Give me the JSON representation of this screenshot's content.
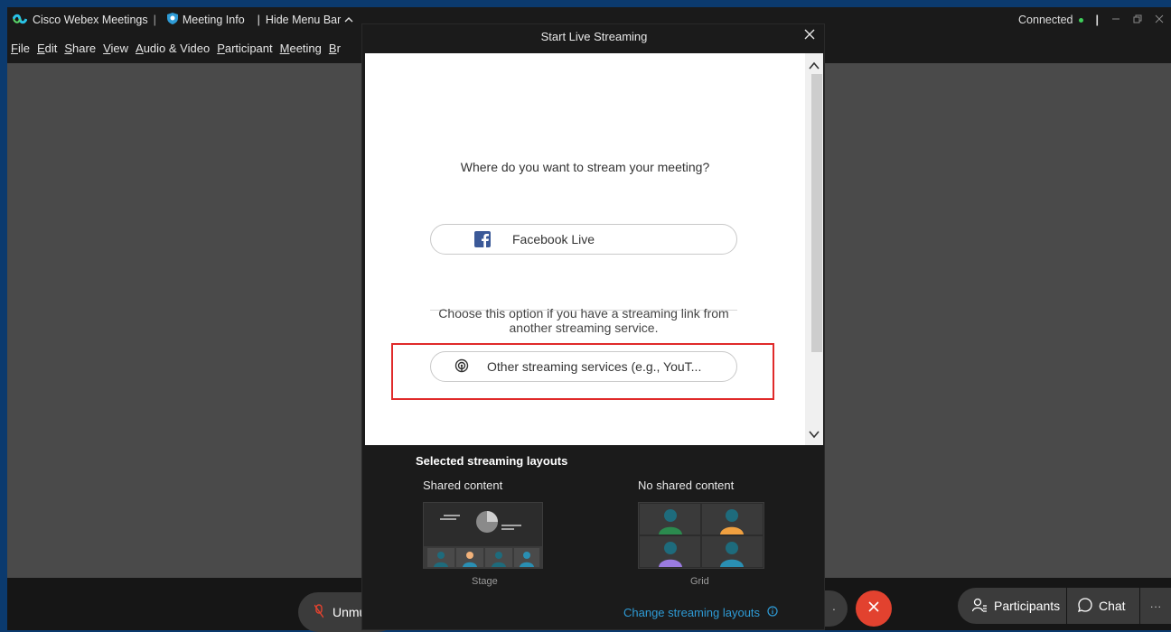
{
  "titlebar": {
    "app_name": "Cisco Webex Meetings",
    "sep1": "|",
    "meeting_info": "Meeting Info",
    "sep2": "|",
    "hide_menu_bar": "Hide Menu Bar",
    "status": "Connected",
    "sep3": "|"
  },
  "menu": {
    "items": [
      {
        "label": "File",
        "key": "F"
      },
      {
        "label": "Edit",
        "key": "E"
      },
      {
        "label": "Share",
        "key": "S"
      },
      {
        "label": "View",
        "key": "V"
      },
      {
        "label": "Audio & Video",
        "key": "A"
      },
      {
        "label": "Participant",
        "key": "P"
      },
      {
        "label": "Meeting",
        "key": "M"
      },
      {
        "label": "Br",
        "key": "B"
      }
    ]
  },
  "dialog": {
    "title": "Start Live Streaming",
    "question": "Where do you want to stream your meeting?",
    "facebook_label": "Facebook Live",
    "choose_line1": "Choose this option if you have a streaming link from",
    "choose_line2": "another streaming service.",
    "other_label": "Other streaming services (e.g., YouT...",
    "layouts_title": "Selected streaming layouts",
    "shared_label": "Shared content",
    "no_shared_label": "No shared content",
    "stage_caption": "Stage",
    "grid_caption": "Grid",
    "change_layouts": "Change streaming layouts"
  },
  "bottombar": {
    "unmute_label": "Unmu",
    "participants_label": "Participants",
    "chat_label": "Chat",
    "more_label": "···"
  },
  "colors": {
    "frame_blue": "#0b3a6e",
    "highlight_red": "#e02a2a",
    "link_blue": "#2e9bd6",
    "end_red": "#e2422f",
    "facebook_blue": "#3b5998",
    "connected_green": "#3fcf5a"
  }
}
